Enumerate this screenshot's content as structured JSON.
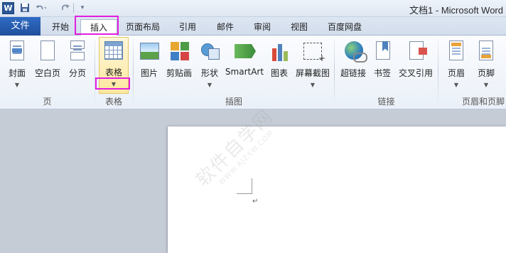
{
  "titlebar": {
    "app_icon": "W",
    "title": "文档1 - Microsoft Word",
    "icons": {
      "save": "save-icon",
      "undo": "undo-icon",
      "redo": "redo-icon"
    }
  },
  "tabs": {
    "file": "文件",
    "items": [
      "开始",
      "插入",
      "页面布局",
      "引用",
      "邮件",
      "审阅",
      "视图",
      "百度网盘"
    ],
    "active": "插入"
  },
  "ribbon": {
    "groups": {
      "pages": {
        "label": "页",
        "buttons": [
          "封面",
          "空白页",
          "分页"
        ]
      },
      "tables": {
        "label": "表格",
        "buttons": [
          "表格"
        ]
      },
      "illustrations": {
        "label": "插图",
        "buttons": [
          "图片",
          "剪贴画",
          "形状",
          "SmartArt",
          "图表",
          "屏幕截图"
        ]
      },
      "links": {
        "label": "链接",
        "buttons": [
          "超链接",
          "书签",
          "交叉引用"
        ]
      },
      "header_footer": {
        "label": "页眉和页脚",
        "buttons": [
          "页眉",
          "页脚"
        ]
      }
    }
  },
  "document": {
    "paragraph_mark": "↵",
    "watermark": "软件自学网",
    "watermark_url": "WWW.RJZXW.COM"
  },
  "colors": {
    "highlight": "#e11ee0",
    "file_tab": "#2b62b4",
    "table_button_bg": "#fde7a0"
  }
}
